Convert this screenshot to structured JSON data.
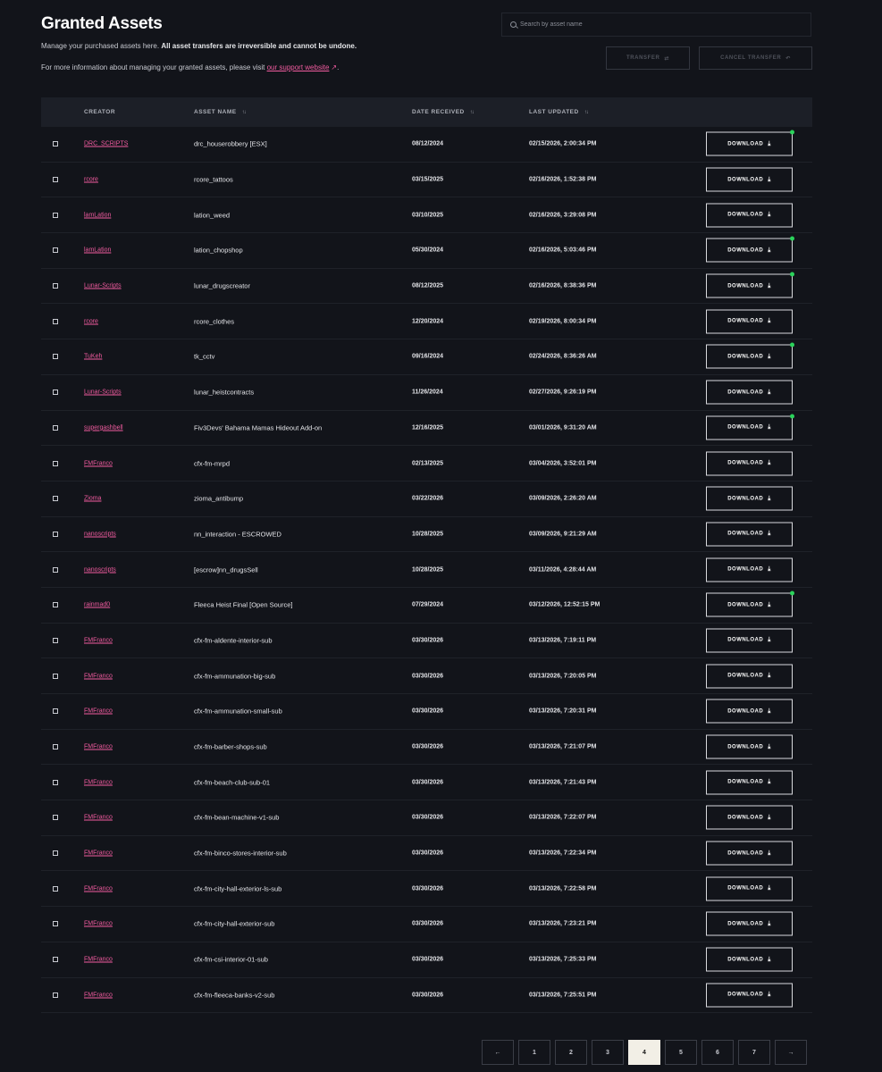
{
  "header": {
    "title": "Granted Assets",
    "desc_plain": "Manage your purchased assets here. ",
    "desc_bold": "All asset transfers are irreversible and cannot be undone.",
    "info_text": "For more information about managing your granted assets, please visit ",
    "support_link": "our support website",
    "info_end": "."
  },
  "search": {
    "placeholder": "Search by asset name",
    "value": ""
  },
  "actions": {
    "transfer_label": "TRANSFER",
    "cancel_transfer_label": "CANCEL TRANSFER"
  },
  "table": {
    "headers": {
      "creator": "CREATOR",
      "asset_name": "ASSET NAME",
      "date_received": "DATE RECEIVED",
      "last_updated": "LAST UPDATED"
    },
    "download_label": "DOWNLOAD",
    "rows": [
      {
        "creator": "DRC_SCRIPTS",
        "asset": "drc_houserobbery [ESX]",
        "received": "08/12/2024",
        "updated": "02/15/2026, 2:00:34 PM",
        "new": true
      },
      {
        "creator": "rcore",
        "asset": "rcore_tattoos",
        "received": "03/15/2025",
        "updated": "02/16/2026, 1:52:38 PM",
        "new": false
      },
      {
        "creator": "lamLation",
        "asset": "lation_weed",
        "received": "03/10/2025",
        "updated": "02/16/2026, 3:29:08 PM",
        "new": false
      },
      {
        "creator": "lamLation",
        "asset": "lation_chopshop",
        "received": "05/30/2024",
        "updated": "02/16/2026, 5:03:46 PM",
        "new": true
      },
      {
        "creator": "Lunar-Scripts",
        "asset": "lunar_drugscreator",
        "received": "08/12/2025",
        "updated": "02/16/2026, 8:38:36 PM",
        "new": true
      },
      {
        "creator": "rcore",
        "asset": "rcore_clothes",
        "received": "12/20/2024",
        "updated": "02/19/2026, 8:00:34 PM",
        "new": false
      },
      {
        "creator": "TuKeh",
        "asset": "tk_cctv",
        "received": "09/16/2024",
        "updated": "02/24/2026, 8:36:26 AM",
        "new": true
      },
      {
        "creator": "Lunar-Scripts",
        "asset": "lunar_heistcontracts",
        "received": "11/26/2024",
        "updated": "02/27/2026, 9:26:19 PM",
        "new": false
      },
      {
        "creator": "supergashbell",
        "asset": "Fiv3Devs' Bahama Mamas Hideout Add-on",
        "received": "12/16/2025",
        "updated": "03/01/2026, 9:31:20 AM",
        "new": true
      },
      {
        "creator": "FMFranco",
        "asset": "cfx-fm-mrpd",
        "received": "02/13/2025",
        "updated": "03/04/2026, 3:52:01 PM",
        "new": false
      },
      {
        "creator": "Zioma",
        "asset": "zioma_antibump",
        "received": "03/22/2026",
        "updated": "03/09/2026, 2:26:20 AM",
        "new": false
      },
      {
        "creator": "nanoscripts",
        "asset": "nn_interaction - ESCROWED",
        "received": "10/28/2025",
        "updated": "03/09/2026, 9:21:29 AM",
        "new": false
      },
      {
        "creator": "nanoscripts",
        "asset": "[escrow]nn_drugsSell",
        "received": "10/28/2025",
        "updated": "03/11/2026, 4:28:44 AM",
        "new": false
      },
      {
        "creator": "rainmad0",
        "asset": "Fleeca Heist Final [Open Source]",
        "received": "07/29/2024",
        "updated": "03/12/2026, 12:52:15 PM",
        "new": true
      },
      {
        "creator": "FMFranco",
        "asset": "cfx-fm-aldente-interior-sub",
        "received": "03/30/2026",
        "updated": "03/13/2026, 7:19:11 PM",
        "new": false
      },
      {
        "creator": "FMFranco",
        "asset": "cfx-fm-ammunation-big-sub",
        "received": "03/30/2026",
        "updated": "03/13/2026, 7:20:05 PM",
        "new": false
      },
      {
        "creator": "FMFranco",
        "asset": "cfx-fm-ammunation-small-sub",
        "received": "03/30/2026",
        "updated": "03/13/2026, 7:20:31 PM",
        "new": false
      },
      {
        "creator": "FMFranco",
        "asset": "cfx-fm-barber-shops-sub",
        "received": "03/30/2026",
        "updated": "03/13/2026, 7:21:07 PM",
        "new": false
      },
      {
        "creator": "FMFranco",
        "asset": "cfx-fm-beach-club-sub-01",
        "received": "03/30/2026",
        "updated": "03/13/2026, 7:21:43 PM",
        "new": false
      },
      {
        "creator": "FMFranco",
        "asset": "cfx-fm-bean-machine-v1-sub",
        "received": "03/30/2026",
        "updated": "03/13/2026, 7:22:07 PM",
        "new": false
      },
      {
        "creator": "FMFranco",
        "asset": "cfx-fm-binco-stores-interior-sub",
        "received": "03/30/2026",
        "updated": "03/13/2026, 7:22:34 PM",
        "new": false
      },
      {
        "creator": "FMFranco",
        "asset": "cfx-fm-city-hall-exterior-ls-sub",
        "received": "03/30/2026",
        "updated": "03/13/2026, 7:22:58 PM",
        "new": false
      },
      {
        "creator": "FMFranco",
        "asset": "cfx-fm-city-hall-exterior-sub",
        "received": "03/30/2026",
        "updated": "03/13/2026, 7:23:21 PM",
        "new": false
      },
      {
        "creator": "FMFranco",
        "asset": "cfx-fm-csi-interior-01-sub",
        "received": "03/30/2026",
        "updated": "03/13/2026, 7:25:33 PM",
        "new": false
      },
      {
        "creator": "FMFranco",
        "asset": "cfx-fm-fleeca-banks-v2-sub",
        "received": "03/30/2026",
        "updated": "03/13/2026, 7:25:51 PM",
        "new": false
      }
    ]
  },
  "pagination": {
    "pages": [
      "1",
      "2",
      "3",
      "4",
      "5",
      "6",
      "7"
    ],
    "current": "4"
  },
  "colors": {
    "accent_link": "#f25ca0",
    "new_dot": "#2bd35b",
    "background": "#12141a",
    "header_bg": "#1c1f27",
    "active_page": "#f2efe6"
  },
  "icons": {
    "search": "search-icon",
    "transfer": "transfer-icon",
    "cancel": "undo-icon",
    "download": "download-icon",
    "external": "external-link-icon",
    "sort": "sort-icon",
    "prev": "arrow-left-icon",
    "next": "arrow-right-icon"
  }
}
